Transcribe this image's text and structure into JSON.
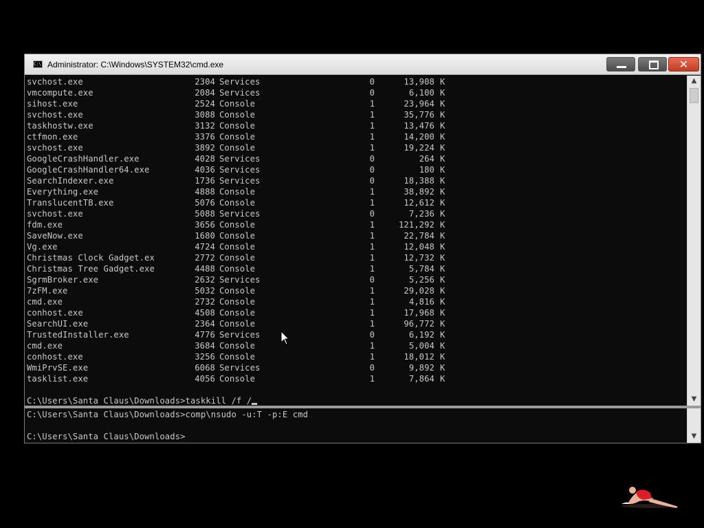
{
  "window": {
    "title": "Administrator: C:\\Windows\\SYSTEM32\\cmd.exe",
    "icon_label": "C:\\",
    "controls": {
      "close_glyph": "✕"
    }
  },
  "processes": [
    {
      "name": "svchost.exe",
      "pid": "2304",
      "session": "Services",
      "num": "0",
      "mem": "13,908",
      "unit": "K"
    },
    {
      "name": "vmcompute.exe",
      "pid": "2084",
      "session": "Services",
      "num": "0",
      "mem": "6,100",
      "unit": "K"
    },
    {
      "name": "sihost.exe",
      "pid": "2524",
      "session": "Console",
      "num": "1",
      "mem": "23,964",
      "unit": "K"
    },
    {
      "name": "svchost.exe",
      "pid": "3088",
      "session": "Console",
      "num": "1",
      "mem": "35,776",
      "unit": "K"
    },
    {
      "name": "taskhostw.exe",
      "pid": "3132",
      "session": "Console",
      "num": "1",
      "mem": "13,476",
      "unit": "K"
    },
    {
      "name": "ctfmon.exe",
      "pid": "3376",
      "session": "Console",
      "num": "1",
      "mem": "14,200",
      "unit": "K"
    },
    {
      "name": "svchost.exe",
      "pid": "3892",
      "session": "Console",
      "num": "1",
      "mem": "19,224",
      "unit": "K"
    },
    {
      "name": "GoogleCrashHandler.exe",
      "pid": "4028",
      "session": "Services",
      "num": "0",
      "mem": "264",
      "unit": "K"
    },
    {
      "name": "GoogleCrashHandler64.exe",
      "pid": "4036",
      "session": "Services",
      "num": "0",
      "mem": "180",
      "unit": "K"
    },
    {
      "name": "SearchIndexer.exe",
      "pid": "1736",
      "session": "Services",
      "num": "0",
      "mem": "18,388",
      "unit": "K"
    },
    {
      "name": "Everything.exe",
      "pid": "4888",
      "session": "Console",
      "num": "1",
      "mem": "38,892",
      "unit": "K"
    },
    {
      "name": "TranslucentTB.exe",
      "pid": "5076",
      "session": "Console",
      "num": "1",
      "mem": "12,612",
      "unit": "K"
    },
    {
      "name": "svchost.exe",
      "pid": "5088",
      "session": "Services",
      "num": "0",
      "mem": "7,236",
      "unit": "K"
    },
    {
      "name": "fdm.exe",
      "pid": "3656",
      "session": "Console",
      "num": "1",
      "mem": "121,292",
      "unit": "K"
    },
    {
      "name": "SaveNow.exe",
      "pid": "1680",
      "session": "Console",
      "num": "1",
      "mem": "22,784",
      "unit": "K"
    },
    {
      "name": "Vg.exe",
      "pid": "4724",
      "session": "Console",
      "num": "1",
      "mem": "12,048",
      "unit": "K"
    },
    {
      "name": "Christmas Clock Gadget.ex",
      "pid": "2772",
      "session": "Console",
      "num": "1",
      "mem": "12,732",
      "unit": "K"
    },
    {
      "name": "Christmas Tree Gadget.exe",
      "pid": "4488",
      "session": "Console",
      "num": "1",
      "mem": "5,784",
      "unit": "K"
    },
    {
      "name": "SgrmBroker.exe",
      "pid": "2632",
      "session": "Services",
      "num": "0",
      "mem": "5,256",
      "unit": "K"
    },
    {
      "name": "7zFM.exe",
      "pid": "5032",
      "session": "Console",
      "num": "1",
      "mem": "29,028",
      "unit": "K"
    },
    {
      "name": "cmd.exe",
      "pid": "2732",
      "session": "Console",
      "num": "1",
      "mem": "4,816",
      "unit": "K"
    },
    {
      "name": "conhost.exe",
      "pid": "4508",
      "session": "Console",
      "num": "1",
      "mem": "17,968",
      "unit": "K"
    },
    {
      "name": "SearchUI.exe",
      "pid": "2364",
      "session": "Console",
      "num": "1",
      "mem": "96,772",
      "unit": "K"
    },
    {
      "name": "TrustedInstaller.exe",
      "pid": "4776",
      "session": "Services",
      "num": "0",
      "mem": "6,192",
      "unit": "K"
    },
    {
      "name": "cmd.exe",
      "pid": "3684",
      "session": "Console",
      "num": "1",
      "mem": "5,004",
      "unit": "K"
    },
    {
      "name": "conhost.exe",
      "pid": "3256",
      "session": "Console",
      "num": "1",
      "mem": "18,012",
      "unit": "K"
    },
    {
      "name": "WmiPrvSE.exe",
      "pid": "6068",
      "session": "Services",
      "num": "0",
      "mem": "9,892",
      "unit": "K"
    },
    {
      "name": "tasklist.exe",
      "pid": "4056",
      "session": "Console",
      "num": "1",
      "mem": "7,864",
      "unit": "K"
    }
  ],
  "prompt_top": "C:\\Users\\Santa Claus\\Downloads>taskkill /f /",
  "bottom_lines": [
    "C:\\Users\\Santa Claus\\Downloads>comp\\nsudo -u:T -p:E cmd",
    "",
    "C:\\Users\\Santa Claus\\Downloads>"
  ],
  "scroll": {
    "up_arrow": "▲",
    "down_arrow": "▼"
  }
}
